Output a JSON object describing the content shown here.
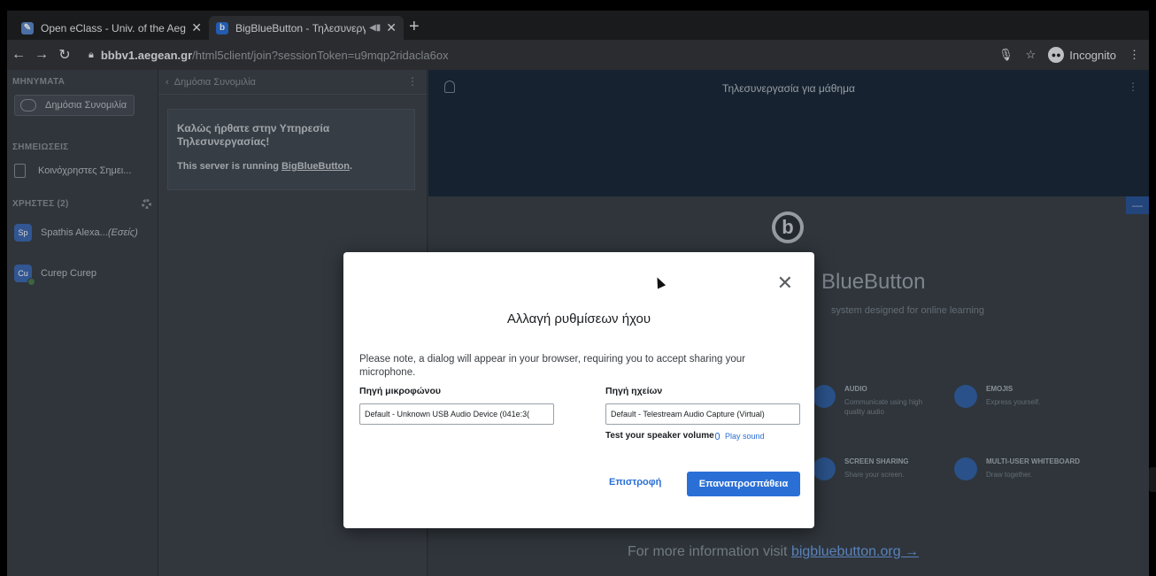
{
  "browser": {
    "tabs": [
      {
        "title": "Open eClass - Univ. of the Aege",
        "favicon": "eclass-icon"
      },
      {
        "title": "BigBlueButton - Τηλεσυνεργ",
        "favicon": "bbb-icon"
      }
    ],
    "url_host": "bbbv1.aegean.gr",
    "url_rest": "/html5client/join?sessionToken=u9mqp2ridacla6ox",
    "incognito_label": "Incognito"
  },
  "userlist": {
    "messages_header": "ΜΗΝΥΜΑΤΑ",
    "public_chat": "Δημόσια Συνομιλία",
    "notes_header": "ΣΗΜΕΙΩΣΕΙΣ",
    "shared_notes": "Κοινόχρηστες Σημει...",
    "users_header": "ΧΡΗΣΤΕΣ (2)",
    "users": [
      {
        "initials": "Sp",
        "name": "Spathis Alexa...",
        "you": "(Εσείς)"
      },
      {
        "initials": "Cu",
        "name": "Curep Curep",
        "you": ""
      }
    ]
  },
  "chat": {
    "header": "Δημόσια Συνομιλία",
    "welcome_title": "Καλώς ήρθατε στην Υπηρεσία Τηλεσυνεργασίας!",
    "welcome_text_prefix": "This server is running ",
    "welcome_link": "BigBlueButton",
    "welcome_text_suffix": "."
  },
  "main": {
    "meeting_title": "Τηλεσυνεργασία για μάθημα",
    "logo_glyph": "b",
    "bbb_title": "BlueButton",
    "bbb_subtitle": "system designed for online learning",
    "features": [
      {
        "name": "AUDIO",
        "desc": "Communicate using high quality audio"
      },
      {
        "name": "EMOJIS",
        "desc": "Express yourself."
      },
      {
        "name": "SCREEN SHARING",
        "desc": "Share your screen."
      },
      {
        "name": "MULTI-USER WHITEBOARD",
        "desc": "Draw together."
      }
    ],
    "more_info_prefix": "For more information visit ",
    "more_info_link": "bigbluebutton.org →"
  },
  "modal": {
    "title": "Αλλαγή ρυθμίσεων ήχου",
    "note": "Please note, a dialog will appear in your browser, requiring you to accept sharing your microphone.",
    "mic_label": "Πηγή μικροφώνου",
    "mic_value": "Default - Unknown USB Audio Device (041e:3(",
    "speaker_label": "Πηγή ηχείων",
    "speaker_value": "Default - Telestream Audio Capture (Virtual)",
    "test_label": "Test your speaker volume",
    "play_sound": "Play sound",
    "back_button": "Επιστροφή",
    "retry_button": "Επαναπροσπάθεια"
  }
}
